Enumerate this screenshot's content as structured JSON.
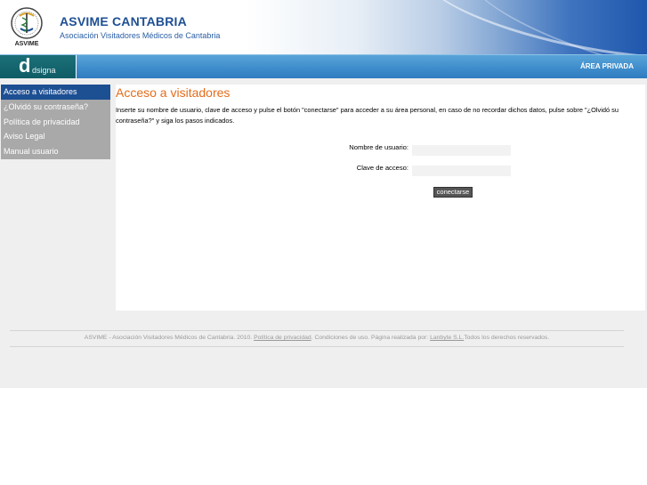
{
  "header": {
    "title": "ASVIME CANTABRIA",
    "subtitle": "Asociación Visitadores Médicos de Cantabria",
    "logo_text": "ASVIME"
  },
  "navbar": {
    "brand_word": "dsigna",
    "area_privada": "ÁREA PRIVADA"
  },
  "sidebar": {
    "items": [
      {
        "label": "Acceso a visitadores"
      },
      {
        "label": "¿Olvidó su contraseña?"
      },
      {
        "label": "Política de privacidad"
      },
      {
        "label": "Aviso Legal"
      },
      {
        "label": "Manual usuario"
      }
    ]
  },
  "main": {
    "title": "Acceso a visitadores",
    "intro": "Inserte su nombre de usuario, clave de acceso y pulse el botón \"conectarse\" para acceder a su área personal, en caso de no recordar dichos datos, pulse sobre \"¿Olvidó su contraseña?\" y siga los pasos indicados.",
    "username_label": "Nombre de usuario:",
    "password_label": "Clave de acceso:",
    "username_value": "",
    "password_value": "",
    "submit_label": "conectarse"
  },
  "footer": {
    "prefix": "ASVIME - Asociación Visitadores Médicos de Cantabria. 2010.",
    "privacy_link": "Política de privacidad",
    "middle": ". Condiciones de uso. Página realizada por:",
    "company_link": "Lanbyte S.L.",
    "suffix": "Todos los derechos reservados."
  },
  "colors": {
    "accent_title": "#e46c1b",
    "header_blue": "#1d4f93",
    "nav_blue": "#3f8dcc",
    "sidebar_grey": "#a9a9a9"
  }
}
